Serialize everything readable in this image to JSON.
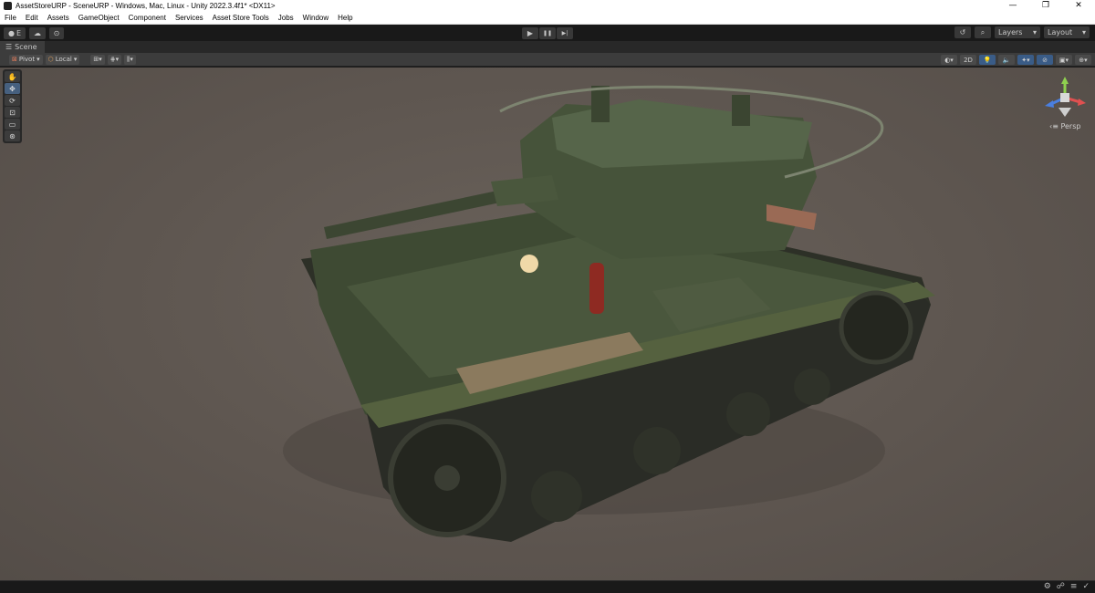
{
  "window": {
    "title": "AssetStoreURP - SceneURP - Windows, Mac, Linux - Unity 2022.3.4f1* <DX11>",
    "minimize": "—",
    "maximize": "❐",
    "close": "✕"
  },
  "menu": [
    "File",
    "Edit",
    "Assets",
    "GameObject",
    "Component",
    "Services",
    "Asset Store Tools",
    "Jobs",
    "Window",
    "Help"
  ],
  "toolbar": {
    "account_label": "E",
    "play": "▶",
    "pause": "❚❚",
    "step": "▶|",
    "layers_label": "Layers",
    "layout_label": "Layout"
  },
  "tab": {
    "label": "Scene"
  },
  "scene_toolbar": {
    "pivot_label": "Pivot",
    "local_label": "Local",
    "mode_2d": "2D",
    "view_label": "Persp"
  },
  "colors": {
    "viewport_bg": "#5e5650",
    "accent": "#3a5c87",
    "tank_green": "#3e4a33"
  },
  "icons": {
    "play": "play-icon",
    "pause": "pause-icon",
    "step": "step-icon",
    "hand": "hand-tool-icon",
    "move": "move-tool-icon",
    "rotate": "rotate-tool-icon",
    "scale": "scale-tool-icon",
    "rect": "rect-tool-icon",
    "transform": "transform-tool-icon"
  }
}
